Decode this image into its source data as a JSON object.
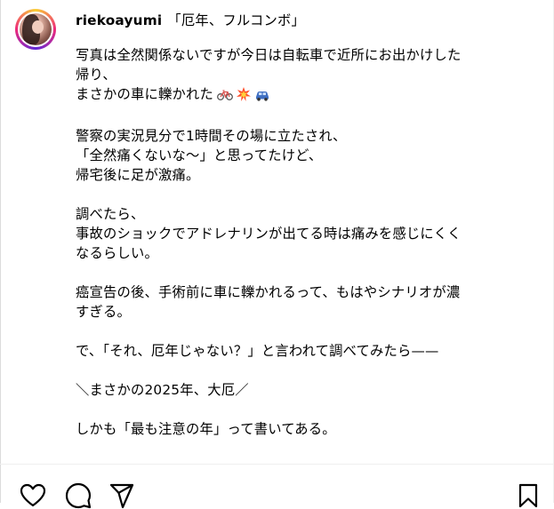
{
  "post": {
    "username": "riekoayumi",
    "title": "「厄年、フルコンボ」"
  },
  "caption": {
    "p1": {
      "l1": "写真は全然関係ないですが今日は自転車で近所にお出かけした",
      "l2": "帰り、",
      "l3": "まさかの車に轢かれた"
    },
    "p2": {
      "l1": "警察の実況見分で1時間その場に立たされ、",
      "l2": "「全然痛くないな〜」と思ってたけど、",
      "l3": "帰宅後に足が激痛。"
    },
    "p3": {
      "l1": "調べたら、",
      "l2": "事故のショックでアドレナリンが出てる時は痛みを感じにくく",
      "l3": "なるらしい。"
    },
    "p4": {
      "l1": "癌宣告の後、手術前に車に轢かれるって、もはやシナリオが濃",
      "l2": "すぎる。"
    },
    "p5": {
      "l1": "で、「それ、厄年じゃない？」と言われて調べてみたら——"
    },
    "p6": {
      "l1": "＼まさかの2025年、大厄／"
    },
    "p7": {
      "l1": "しかも「最も注意の年」って書いてある。"
    }
  },
  "emojis": [
    "bicycle-icon",
    "collision-icon",
    "car-icon"
  ],
  "actions": [
    "like-icon",
    "comment-icon",
    "share-icon",
    "save-icon"
  ],
  "colors": {
    "text": "#000000",
    "divider": "#efefef",
    "ring_start": "#f9ce34",
    "ring_mid": "#ee2a7b",
    "ring_end": "#6228d7"
  }
}
